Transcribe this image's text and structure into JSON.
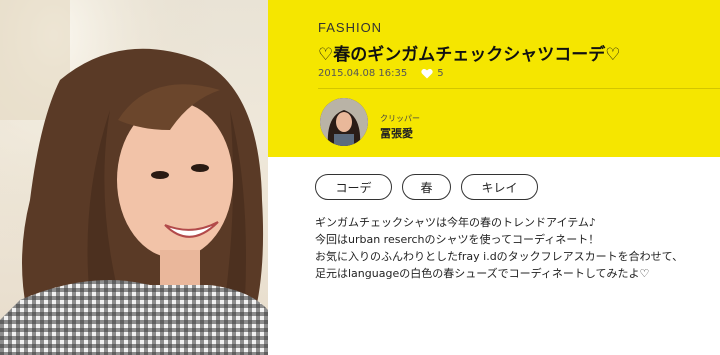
{
  "article": {
    "category": "FASHION",
    "title": "♡春のギンガムチェックシャツコーデ♡",
    "date": "2015.04.08 16:35",
    "likes": "5"
  },
  "clipper": {
    "label": "クリッパー",
    "name": "冨張愛"
  },
  "tags": [
    "コーデ",
    "春",
    "キレイ"
  ],
  "body": [
    "ギンガムチェックシャツは今年の春のトレンドアイテム♪",
    "今回はurban reserchのシャツを使ってコーディネート！",
    "お気に入りのふんわりとしたfray i.dのタックフレアスカートを合わせて、",
    "足元はlanguageの白色の春シューズでコーディネートしてみたよ♡"
  ],
  "colors": {
    "header_bg": "#f5e600",
    "text": "#222222"
  },
  "icons": {
    "like": "heart-icon"
  }
}
